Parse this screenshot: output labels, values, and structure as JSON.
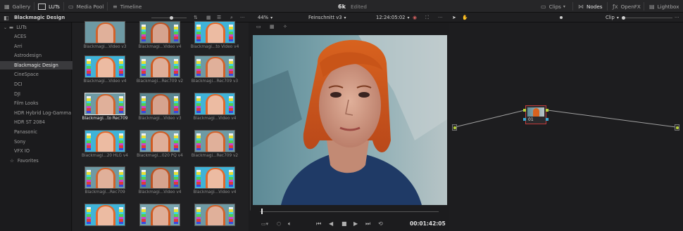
{
  "topbar": {
    "gallery": "Gallery",
    "luts": "LUTs",
    "media_pool": "Media Pool",
    "timeline": "Timeline",
    "project_name": "6k",
    "project_status": "Edited",
    "clips": "Clips",
    "nodes": "Nodes",
    "openfx": "OpenFX",
    "lightbox": "Lightbox"
  },
  "subbar": {
    "lut_folder": "Blackmagic Design",
    "zoom": "44%",
    "timeline_name": "Feinschnitt v3",
    "timecode": "12:24:05:02",
    "node_mode": "Clip"
  },
  "tree": {
    "root": "LUTs",
    "items": [
      "ACES",
      "Arri",
      "Astrodesign",
      "Blackmagic Design",
      "CineSpace",
      "DCI",
      "DJI",
      "Film Looks",
      "HDR Hybrid Log-Gamma",
      "HDR ST 2084",
      "Panasonic",
      "Sony",
      "VFX IO"
    ],
    "selected": "Blackmagic Design",
    "favorites": "Favorites"
  },
  "luts": {
    "labels": [
      "Blackmagi...Video v3",
      "Blackmagi...Video v4",
      "Blackmagi...to Video v4",
      "Blackmagi...Video v4",
      "Blackmagi...Rec709 v2",
      "Blackmagi...Rec709 v3",
      "Blackmagi...to Rec709",
      "Blackmagi...Video v3",
      "Blackmagi...Video v4",
      "Blackmagi...20 HLG v4",
      "Blackmagi...020 PQ v4",
      "Blackmagi...Rec709 v2",
      "Blackmagi...Rec709",
      "Blackmagi...Video v4",
      "Blackmagi...Video v4",
      "",
      "",
      ""
    ],
    "selected_index": 6
  },
  "viewer": {
    "timecode": "00:01:42:05"
  },
  "node": {
    "label": "01"
  },
  "colors": {
    "accent_node": "#c23a3a",
    "link_green": "#b8d23a",
    "link_blue": "#3aa8d2"
  }
}
